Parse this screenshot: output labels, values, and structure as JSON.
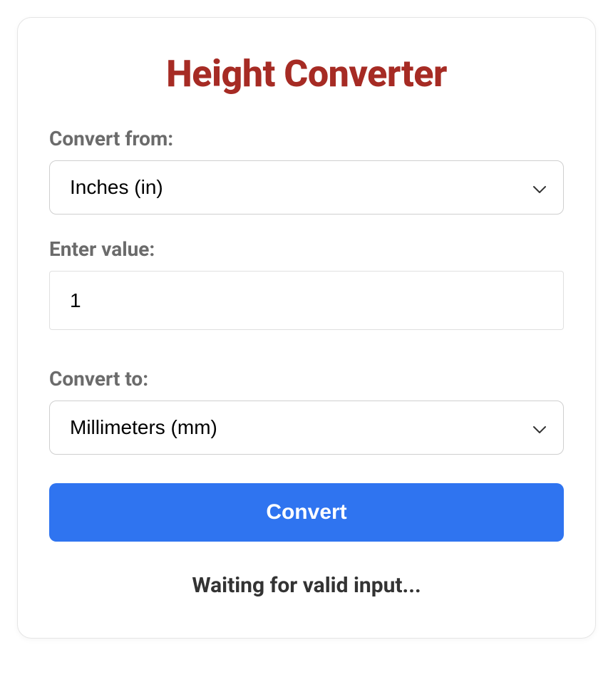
{
  "title": "Height Converter",
  "from": {
    "label": "Convert from:",
    "selected": "Inches (in)"
  },
  "value": {
    "label": "Enter value:",
    "input": "1"
  },
  "to": {
    "label": "Convert to:",
    "selected": "Millimeters (mm)"
  },
  "button": {
    "label": "Convert"
  },
  "status": "Waiting for valid input...",
  "colors": {
    "accent": "#a62b24",
    "primary": "#2f74f0"
  }
}
